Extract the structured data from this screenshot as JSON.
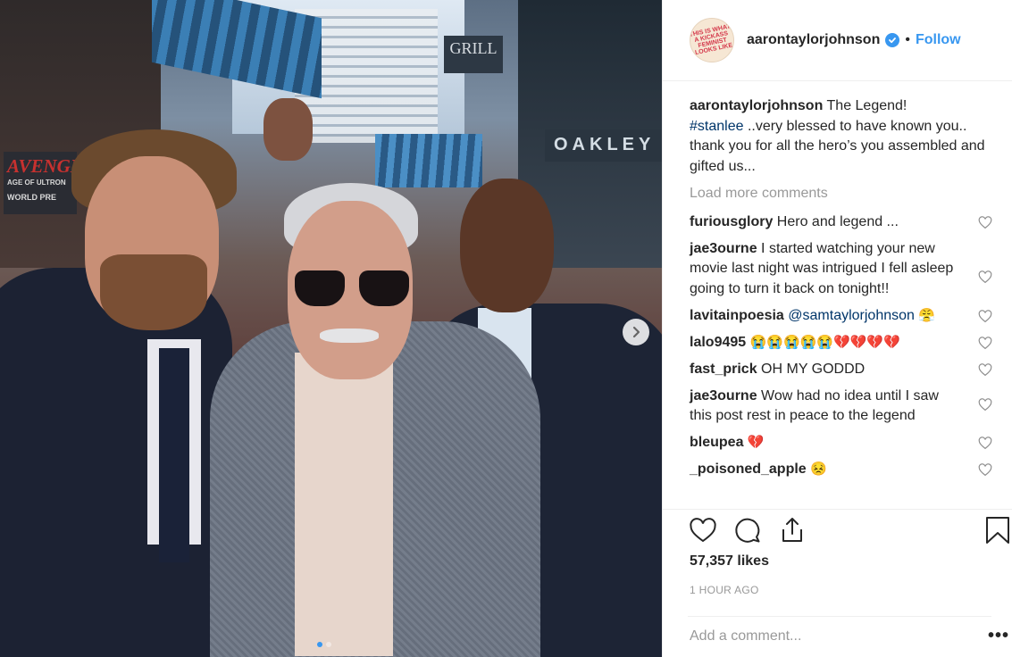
{
  "post": {
    "author": "aarontaylorjohnson",
    "avatar_text": "THIS IS WHAT A KICKASS FEMINIST LOOKS LIKE",
    "separator": "•",
    "follow_label": "Follow",
    "caption": {
      "username": "aarontaylorjohnson",
      "text_before": "The Legend!",
      "hashtag": "#stanlee",
      "text_after": "..very blessed to have known you.. thank you for all the hero’s you assembled and gifted us..."
    },
    "load_more_label": "Load more comments",
    "comments": [
      {
        "user": "furiousglory",
        "text": "Hero and legend ...",
        "mention": "",
        "emoji": ""
      },
      {
        "user": "jae3ourne",
        "text": "I started watching your new movie last night was intrigued I fell asleep going to turn it back on tonight!!",
        "mention": "",
        "emoji": ""
      },
      {
        "user": "lavitainpoesia",
        "text": "",
        "mention": "@samtaylorjohnson",
        "emoji": "😤"
      },
      {
        "user": "lalo9495",
        "text": "",
        "mention": "",
        "emoji": "😭😭😭😭😭💔💔💔💔"
      },
      {
        "user": "fast_prick",
        "text": "OH MY GODDD",
        "mention": "",
        "emoji": ""
      },
      {
        "user": "jae3ourne",
        "text": "Wow had no idea until I saw this post rest in peace to the legend",
        "mention": "",
        "emoji": ""
      },
      {
        "user": "bleupea",
        "text": "",
        "mention": "",
        "emoji": "💔"
      },
      {
        "user": "_poisoned_apple",
        "text": "",
        "mention": "",
        "emoji": "😣"
      }
    ],
    "likes": "57,357 likes",
    "time_ago": "1 HOUR AGO",
    "add_comment_placeholder": "Add a comment...",
    "more_label": "•••"
  },
  "photo": {
    "signs": {
      "avengers": "AVENGERS",
      "avengers_sub": "AGE OF ULTRON",
      "avengers_sub2": "WORLD PRE",
      "grill": "GRILL",
      "oakley": "OAKLEY"
    },
    "carousel": {
      "total_slides": 2,
      "active_slide": 1
    }
  },
  "colors": {
    "accent": "#3897f0",
    "text": "#262626",
    "muted": "#999999",
    "hashtag": "#003569",
    "divider": "#efefef"
  }
}
